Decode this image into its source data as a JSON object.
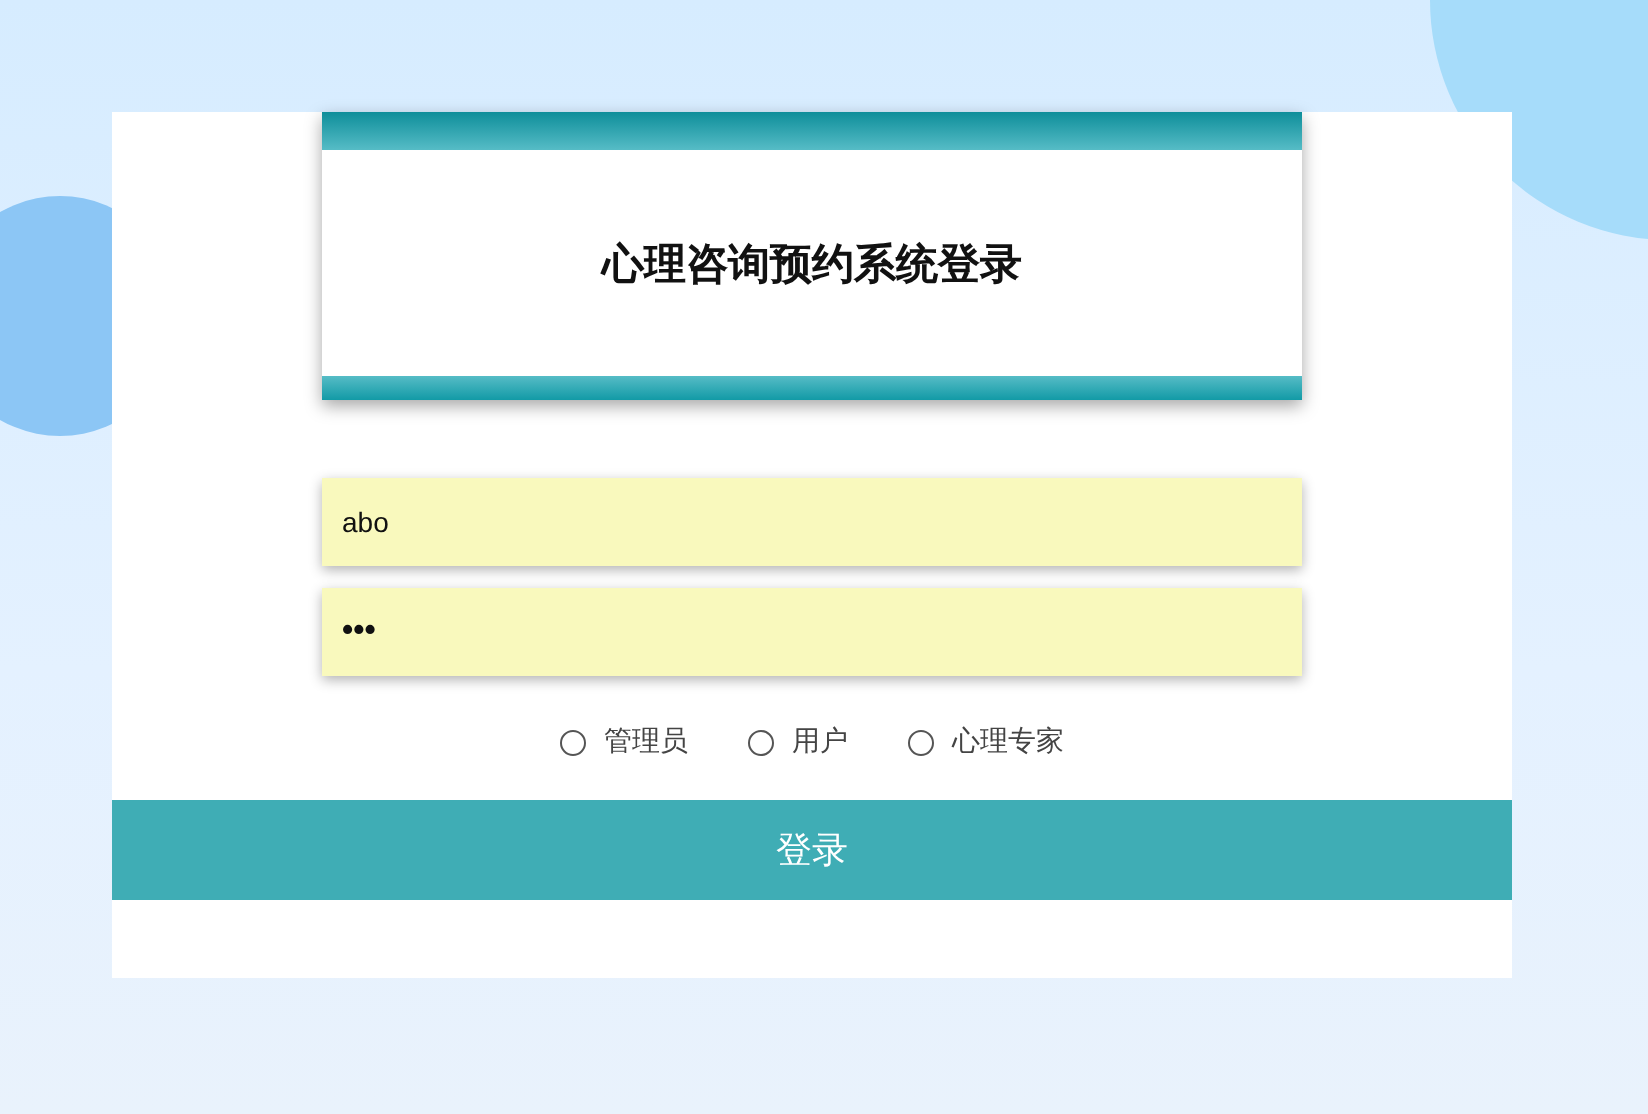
{
  "title": "心理咨询预约系统登录",
  "fields": [
    {
      "kind": "text",
      "value": "abo"
    },
    {
      "kind": "password",
      "value": "•••"
    }
  ],
  "roles": [
    {
      "label": "管理员",
      "selected": false
    },
    {
      "label": "用户",
      "selected": false
    },
    {
      "label": "心理专家",
      "selected": false
    }
  ],
  "login_button": "登录"
}
